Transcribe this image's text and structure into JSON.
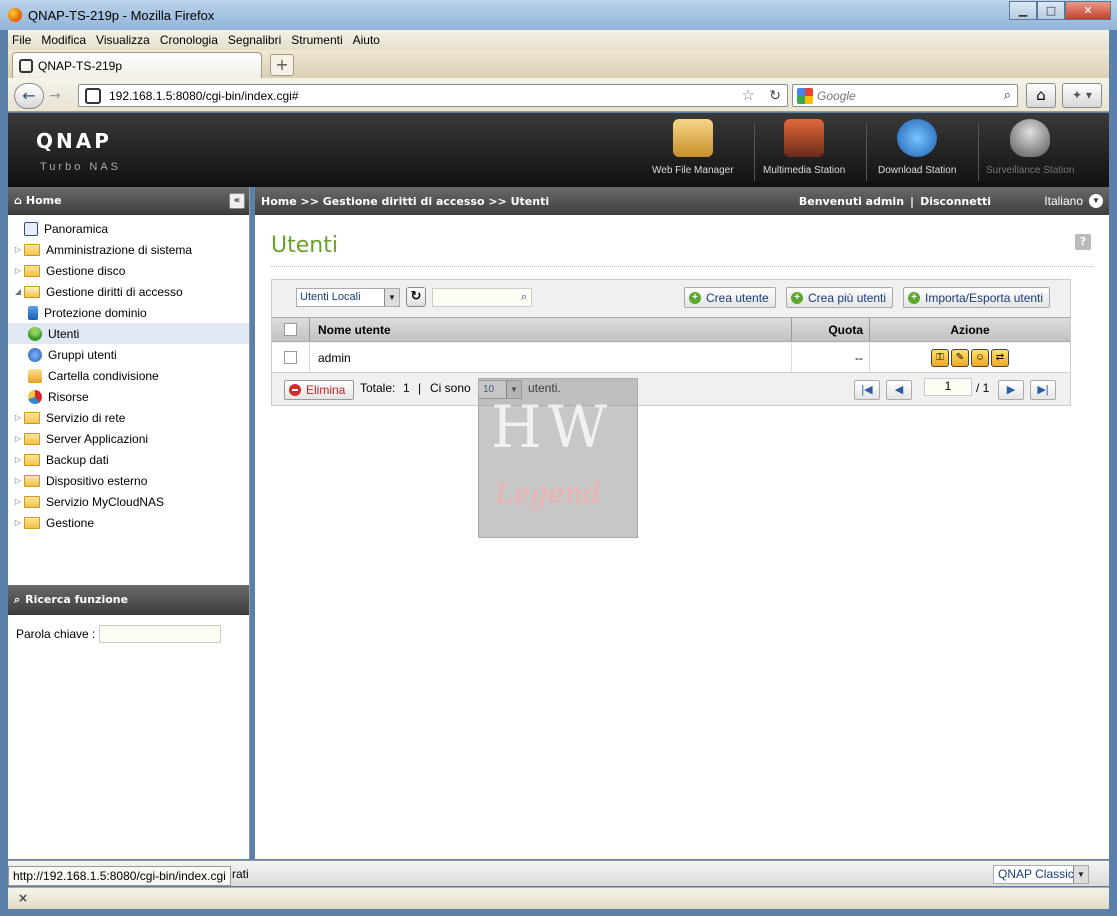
{
  "window": {
    "title": "QNAP-TS-219p - Mozilla Firefox"
  },
  "menu": [
    "File",
    "Modifica",
    "Visualizza",
    "Cronologia",
    "Segnalibri",
    "Strumenti",
    "Aiuto"
  ],
  "tab": {
    "title": "QNAP-TS-219p",
    "new_tab": "+"
  },
  "nav": {
    "url": "192.168.1.5:8080/cgi-bin/index.cgi#",
    "search_placeholder": "Google"
  },
  "header": {
    "logo": "QNAP",
    "subtitle": "Turbo NAS",
    "stations": [
      {
        "label": "Web File Manager",
        "icon": "folder-magnifier-icon"
      },
      {
        "label": "Multimedia Station",
        "icon": "film-icon"
      },
      {
        "label": "Download Station",
        "icon": "globe-download-icon"
      },
      {
        "label": "Surveillance Station",
        "icon": "camera-icon"
      }
    ]
  },
  "sidebar": {
    "home_label": "Home",
    "collapse": "«",
    "items": [
      {
        "label": "Panoramica",
        "level": 0,
        "kind": "leaf"
      },
      {
        "label": "Amministrazione di sistema",
        "level": 0,
        "kind": "folder"
      },
      {
        "label": "Gestione disco",
        "level": 0,
        "kind": "folder"
      },
      {
        "label": "Gestione diritti di accesso",
        "level": 0,
        "kind": "folder-open"
      },
      {
        "label": "Protezione dominio",
        "level": 1,
        "kind": "leaf"
      },
      {
        "label": "Utenti",
        "level": 1,
        "kind": "leaf",
        "selected": true
      },
      {
        "label": "Gruppi utenti",
        "level": 1,
        "kind": "leaf"
      },
      {
        "label": "Cartella condivisione",
        "level": 1,
        "kind": "leaf"
      },
      {
        "label": "Risorse",
        "level": 1,
        "kind": "leaf"
      },
      {
        "label": "Servizio di rete",
        "level": 0,
        "kind": "folder"
      },
      {
        "label": "Server Applicazioni",
        "level": 0,
        "kind": "folder"
      },
      {
        "label": "Backup dati",
        "level": 0,
        "kind": "folder"
      },
      {
        "label": "Dispositivo esterno",
        "level": 0,
        "kind": "folder"
      },
      {
        "label": "Servizio MyCloudNAS",
        "level": 0,
        "kind": "folder"
      },
      {
        "label": "Gestione",
        "level": 0,
        "kind": "folder"
      }
    ],
    "search_title": "Ricerca funzione",
    "keyword_label": "Parola chiave :"
  },
  "breadcrumb": {
    "path": "Home >> Gestione diritti di accesso >> Utenti",
    "welcome": "Benvenuti admin",
    "separator": "|",
    "logout": "Disconnetti",
    "language": "Italiano"
  },
  "main": {
    "title": "Utenti",
    "help": "?",
    "user_type": "Utenti Locali",
    "buttons": {
      "create": "Crea utente",
      "create_multi": "Crea più utenti",
      "import_export": "Importa/Esporta utenti"
    },
    "columns": {
      "name": "Nome utente",
      "quota": "Quota",
      "action": "Azione"
    },
    "rows": [
      {
        "name": "admin",
        "quota": "--"
      }
    ],
    "footer": {
      "delete": "Elimina",
      "total_label": "Totale:",
      "total": "1",
      "sep": "|",
      "ci_sono": "Ci sono",
      "page_size": "10",
      "unit": "utenti.",
      "page": "1",
      "pages": "/ 1"
    }
  },
  "watermark": {
    "line1": "HW",
    "line2": "Legend"
  },
  "status": {
    "url": "http://192.168.1.5:8080/cgi-bin/index.cgi",
    "tail": "rati",
    "theme": "QNAP Classic",
    "close": "×"
  }
}
